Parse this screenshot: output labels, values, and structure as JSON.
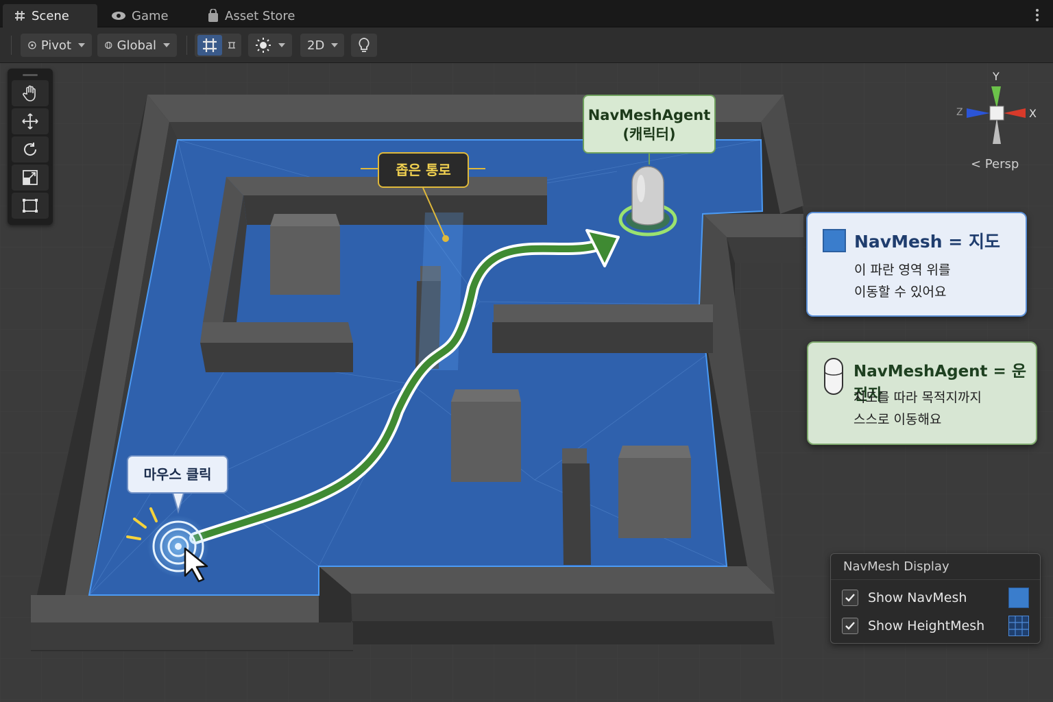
{
  "tabs": [
    {
      "label": "Scene",
      "icon": "hash-icon",
      "active": true
    },
    {
      "label": "Game",
      "icon": "eye-icon",
      "active": false
    },
    {
      "label": "Asset Store",
      "icon": "bag-icon",
      "active": false
    }
  ],
  "toolbar": {
    "pivot_label": "Pivot",
    "global_label": "Global",
    "mode_2d_label": "2D"
  },
  "gizmo": {
    "y_label": "Y",
    "x_label": "X",
    "z_label": "Z",
    "persp_label": "< Persp",
    "colors": {
      "x": "#d83a2a",
      "y": "#6cc24a",
      "z": "#2b55d8"
    }
  },
  "callouts": {
    "agent_line1": "NavMeshAgent",
    "agent_line2": "(캐릭터)",
    "narrow_passage": "좁은 통로",
    "mouse_click": "마우스 클릭"
  },
  "cards": {
    "navmesh": {
      "title": "NavMesh = 지도",
      "line1": "이 파란 영역 위를",
      "line2": "이동할 수 있어요",
      "swatch_color": "#3a7dcc"
    },
    "agent": {
      "title": "NavMeshAgent = 운전자",
      "line1": "지도를 따라 목적지까지",
      "line2": "스스로 이동해요"
    }
  },
  "navmesh_display": {
    "title": "NavMesh Display",
    "show_navmesh": {
      "label": "Show NavMesh",
      "checked": true
    },
    "show_heightmesh": {
      "label": "Show HeightMesh",
      "checked": true
    }
  },
  "colors": {
    "navmesh_blue": "#2f64b4",
    "path_green": "#3f8a32",
    "wall_gray": "#4a4a4a"
  }
}
